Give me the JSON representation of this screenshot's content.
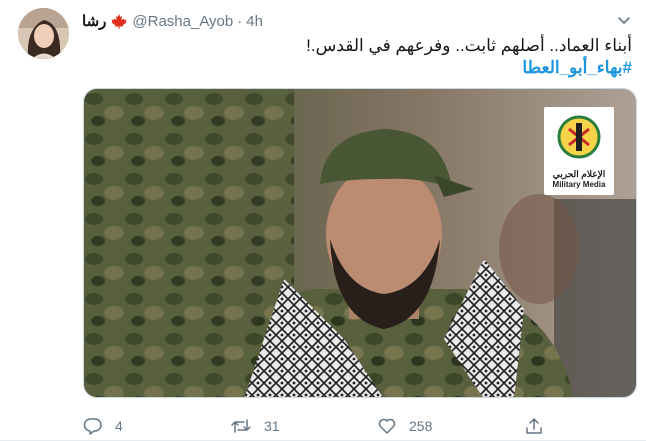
{
  "user": {
    "display_name": "رشا",
    "handle": "@Rasha_Ayob",
    "separator": "·",
    "time": "4h"
  },
  "tweet": {
    "line1": "أبناء العماد.. أصلهم ثابت.. وفرعهم في القدس.!",
    "hashtag": "#بهاء_أبو_العطا"
  },
  "media": {
    "logo_ar": "الإعلام الحربي",
    "logo_en": "Military Media"
  },
  "actions": {
    "replies": "4",
    "retweets": "31",
    "likes": "258"
  },
  "colors": {
    "link": "#1b95e0",
    "muted": "#657786",
    "flag_red": "#e0301e"
  },
  "icons": [
    "maple-leaf-flag-icon",
    "chevron-down-icon",
    "reply-icon",
    "retweet-icon",
    "like-icon",
    "share-icon"
  ]
}
